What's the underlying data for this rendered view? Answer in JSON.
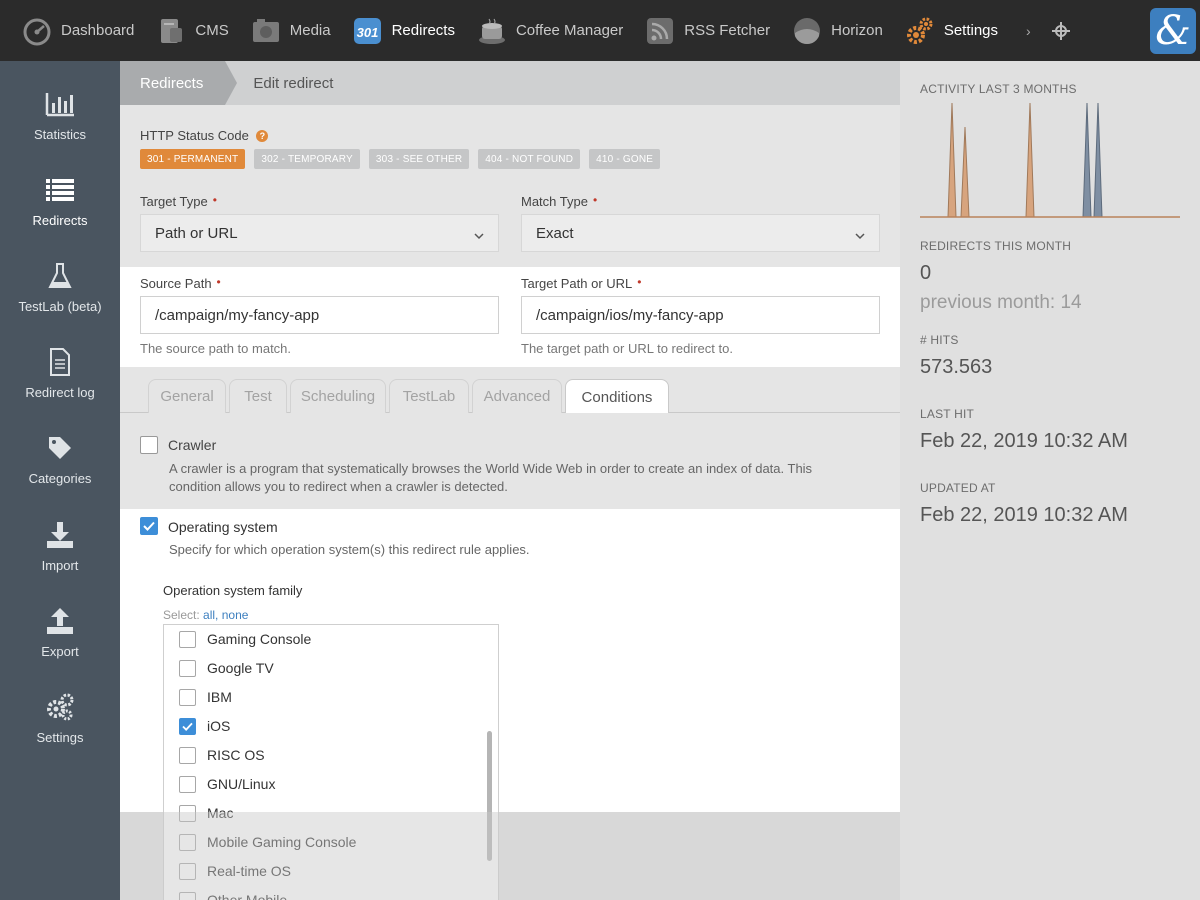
{
  "colors": {
    "topbar_bg": "#2b2b2b",
    "sidebar_bg": "#4a5560",
    "accent_orange": "#e0893a",
    "accent_blue": "#3d8ed8",
    "chart_orange": "#d7a47e",
    "chart_blue": "#7f8fa3"
  },
  "topnav": {
    "items": [
      {
        "label": "Dashboard",
        "icon": "gauge-icon"
      },
      {
        "label": "CMS",
        "icon": "cms-icon"
      },
      {
        "label": "Media",
        "icon": "media-icon"
      },
      {
        "label": "Redirects",
        "icon": "redirect-301-icon",
        "badge": "301"
      },
      {
        "label": "Coffee Manager",
        "icon": "coffee-icon"
      },
      {
        "label": "RSS Fetcher",
        "icon": "rss-icon"
      },
      {
        "label": "Horizon",
        "icon": "horizon-icon"
      },
      {
        "label": "Settings",
        "icon": "gears-icon"
      }
    ],
    "more": "›",
    "logo_text": "&"
  },
  "sidebar": {
    "items": [
      {
        "label": "Statistics",
        "icon": "bar-chart-icon"
      },
      {
        "label": "Redirects",
        "icon": "list-icon"
      },
      {
        "label": "TestLab (beta)",
        "icon": "flask-icon"
      },
      {
        "label": "Redirect log",
        "icon": "document-icon"
      },
      {
        "label": "Categories",
        "icon": "tag-icon"
      },
      {
        "label": "Import",
        "icon": "download-icon"
      },
      {
        "label": "Export",
        "icon": "upload-icon"
      },
      {
        "label": "Settings",
        "icon": "gears-icon"
      }
    ]
  },
  "breadcrumb": {
    "parent": "Redirects",
    "current": "Edit redirect"
  },
  "form": {
    "status_label": "HTTP Status Code",
    "status_codes": [
      "301 - PERMANENT",
      "302 - TEMPORARY",
      "303 - SEE OTHER",
      "404 - NOT FOUND",
      "410 - GONE"
    ],
    "status_selected": "301 - PERMANENT",
    "target_type_label": "Target Type",
    "target_type_value": "Path or URL",
    "match_type_label": "Match Type",
    "match_type_value": "Exact",
    "source_label": "Source Path",
    "source_value": "/campaign/my-fancy-app",
    "source_hint": "The source path to match.",
    "target_label": "Target Path or URL",
    "target_value": "/campaign/ios/my-fancy-app",
    "target_hint": "The target path or URL to redirect to.",
    "required_mark": "•",
    "help_mark": "?"
  },
  "tabs": [
    "General",
    "Test",
    "Scheduling",
    "TestLab",
    "Advanced",
    "Conditions"
  ],
  "active_tab": "Conditions",
  "conditions": {
    "crawler": {
      "label": "Crawler",
      "checked": false,
      "description_line1": "A crawler is a program that systematically browses the World Wide Web in order to create an index of data. This",
      "description_line2": "condition allows you to redirect when a crawler is detected."
    },
    "os": {
      "label": "Operating system",
      "checked": true,
      "description": "Specify for which operation system(s) this redirect rule applies.",
      "family_label": "Operation system family",
      "select_prefix": "Select:",
      "select_all": "all,",
      "select_none": "none",
      "options": [
        {
          "label": "Gaming Console",
          "checked": false
        },
        {
          "label": "Google TV",
          "checked": false
        },
        {
          "label": "IBM",
          "checked": false
        },
        {
          "label": "iOS",
          "checked": true
        },
        {
          "label": "RISC OS",
          "checked": false
        },
        {
          "label": "GNU/Linux",
          "checked": false
        },
        {
          "label": "Mac",
          "checked": false
        },
        {
          "label": "Mobile Gaming Console",
          "checked": false
        },
        {
          "label": "Real-time OS",
          "checked": false
        },
        {
          "label": "Other Mobile",
          "checked": false
        }
      ]
    }
  },
  "stats": {
    "activity_title": "ACTIVITY LAST 3 MONTHS",
    "redirects_month_title": "REDIRECTS THIS MONTH",
    "redirects_month_value": "0",
    "previous_month": "previous month: 14",
    "hits_title": "# HITS",
    "hits_value": "573.563",
    "last_hit_title": "LAST HIT",
    "last_hit_value": "Feb 22, 2019 10:32 AM",
    "updated_title": "UPDATED AT",
    "updated_value": "Feb 22, 2019 10:32 AM"
  }
}
